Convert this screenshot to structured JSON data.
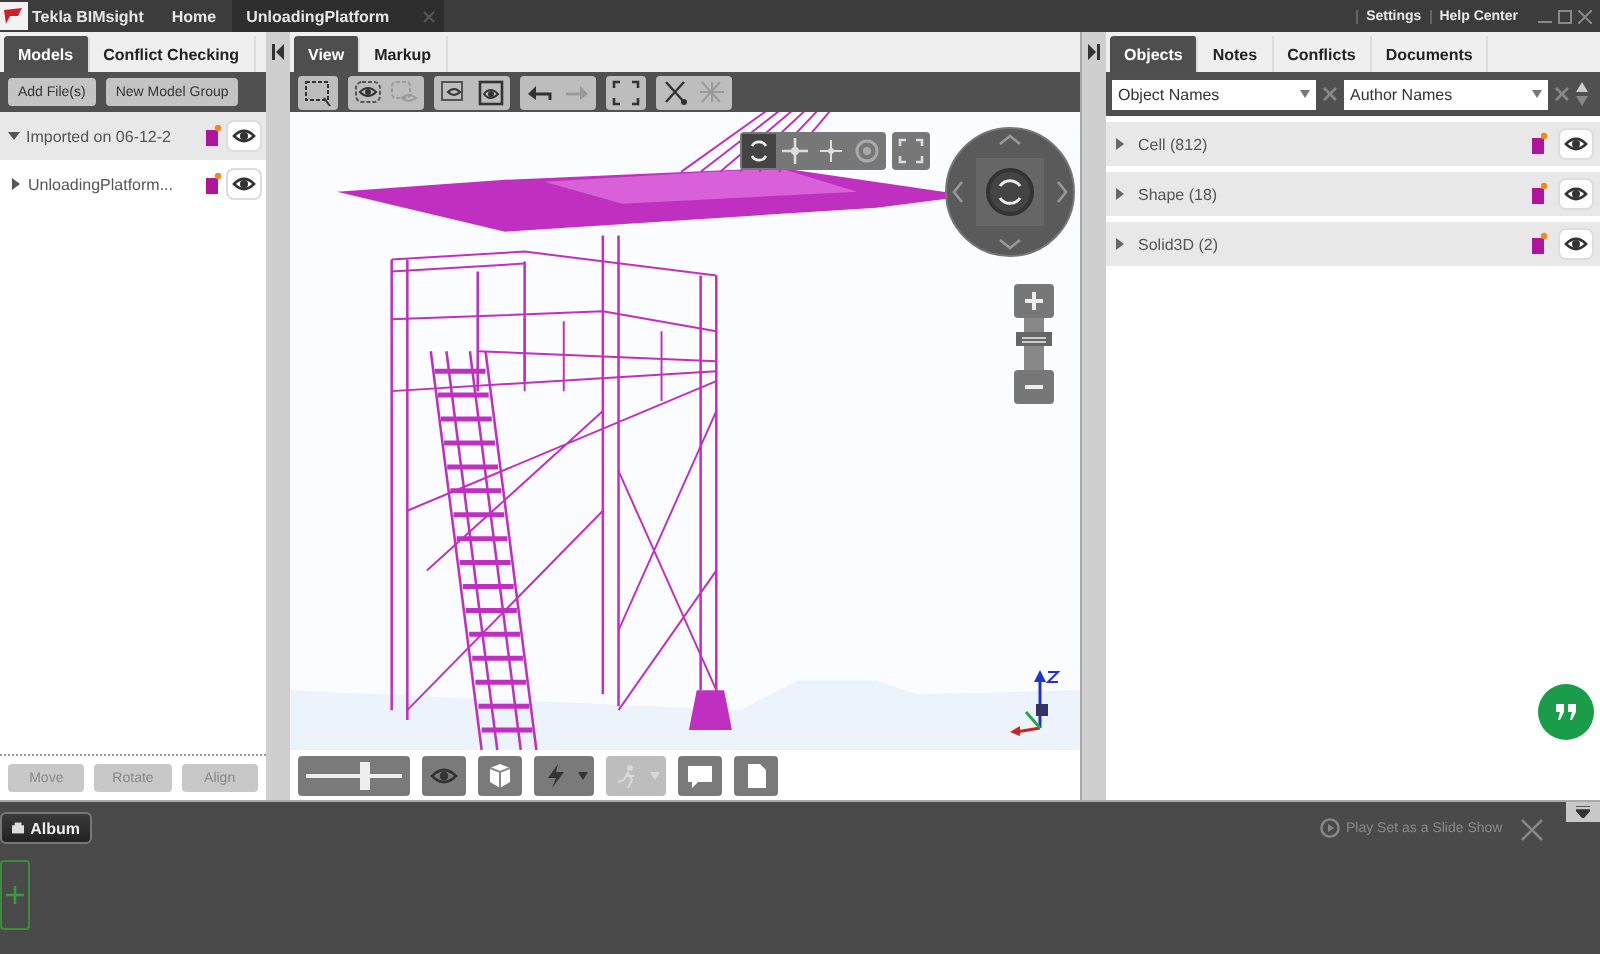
{
  "title_bar": {
    "app_name": "Tekla BIMsight",
    "home": "Home",
    "document_tab": "UnloadingPlatform",
    "links": [
      "Settings",
      "Help Center"
    ]
  },
  "left_panel": {
    "tabs": [
      {
        "label": "Models",
        "selected": true
      },
      {
        "label": "Conflict Checking",
        "selected": false
      }
    ],
    "buttons": [
      "Add File(s)",
      "New Model Group"
    ],
    "tree": [
      {
        "label": "Imported on 06-12-2",
        "expanded": true,
        "selected": true,
        "children": [
          {
            "label": "UnloadingPlatform...",
            "expanded": false,
            "selected": false
          }
        ]
      }
    ],
    "footer_buttons": [
      {
        "label": "Move",
        "disabled": true
      },
      {
        "label": "Rotate",
        "disabled": true
      },
      {
        "label": "Align",
        "disabled": true
      }
    ]
  },
  "view_panel": {
    "tabs": [
      {
        "label": "View",
        "selected": true
      },
      {
        "label": "Markup",
        "selected": false
      }
    ],
    "toolbar": [
      {
        "disabled": false
      },
      {
        "disabled": false
      },
      {
        "disabled": true
      },
      {
        "disabled": false
      },
      {
        "disabled": false
      },
      {
        "disabled": false
      },
      {
        "disabled": true
      },
      {
        "disabled": false
      },
      {
        "disabled": false
      },
      {
        "disabled": true
      }
    ],
    "bottom_toolbar": {
      "slider": {
        "level": 0.6
      },
      "tools": [
        {
          "disabled": false
        },
        {
          "disabled": false
        },
        {
          "disabled": false
        },
        {
          "disabled": true
        },
        {
          "disabled": false
        },
        {
          "disabled": false
        }
      ]
    }
  },
  "right_panel": {
    "tabs": [
      {
        "label": "Objects",
        "selected": true
      },
      {
        "label": "Notes",
        "selected": false
      },
      {
        "label": "Conflicts",
        "selected": false
      },
      {
        "label": "Documents",
        "selected": false
      }
    ],
    "filters": [
      {
        "value": "Object Names"
      },
      {
        "value": "Author Names"
      }
    ],
    "rows": [
      {
        "label": "Cell (812)",
        "expanded": false
      },
      {
        "label": "Shape (18)",
        "expanded": false
      },
      {
        "label": "Solid3D (2)",
        "expanded": false
      }
    ]
  },
  "album": {
    "button": "Album",
    "slideshow": "Play Set as a Slide Show"
  }
}
